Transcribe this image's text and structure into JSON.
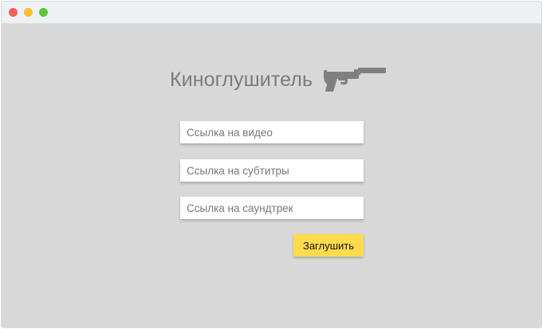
{
  "window": {
    "controls": [
      "close",
      "minimize",
      "maximize"
    ],
    "colors": {
      "close": "#f25f58",
      "minimize": "#fbbe2f",
      "maximize": "#5fc43a"
    }
  },
  "header": {
    "title": "Киноглушитель",
    "icon": "pistol-with-silencer-icon"
  },
  "form": {
    "video_placeholder": "Ссылка на видео",
    "subtitles_placeholder": "Ссылка на субтитры",
    "soundtrack_placeholder": "Ссылка на саундтрек",
    "video_value": "",
    "subtitles_value": "",
    "soundtrack_value": "",
    "submit_label": "Заглушить"
  },
  "colors": {
    "background": "#d8d8d8",
    "title_text": "#7b7b7b",
    "button": "#ffdb4d",
    "icon": "#808080"
  }
}
